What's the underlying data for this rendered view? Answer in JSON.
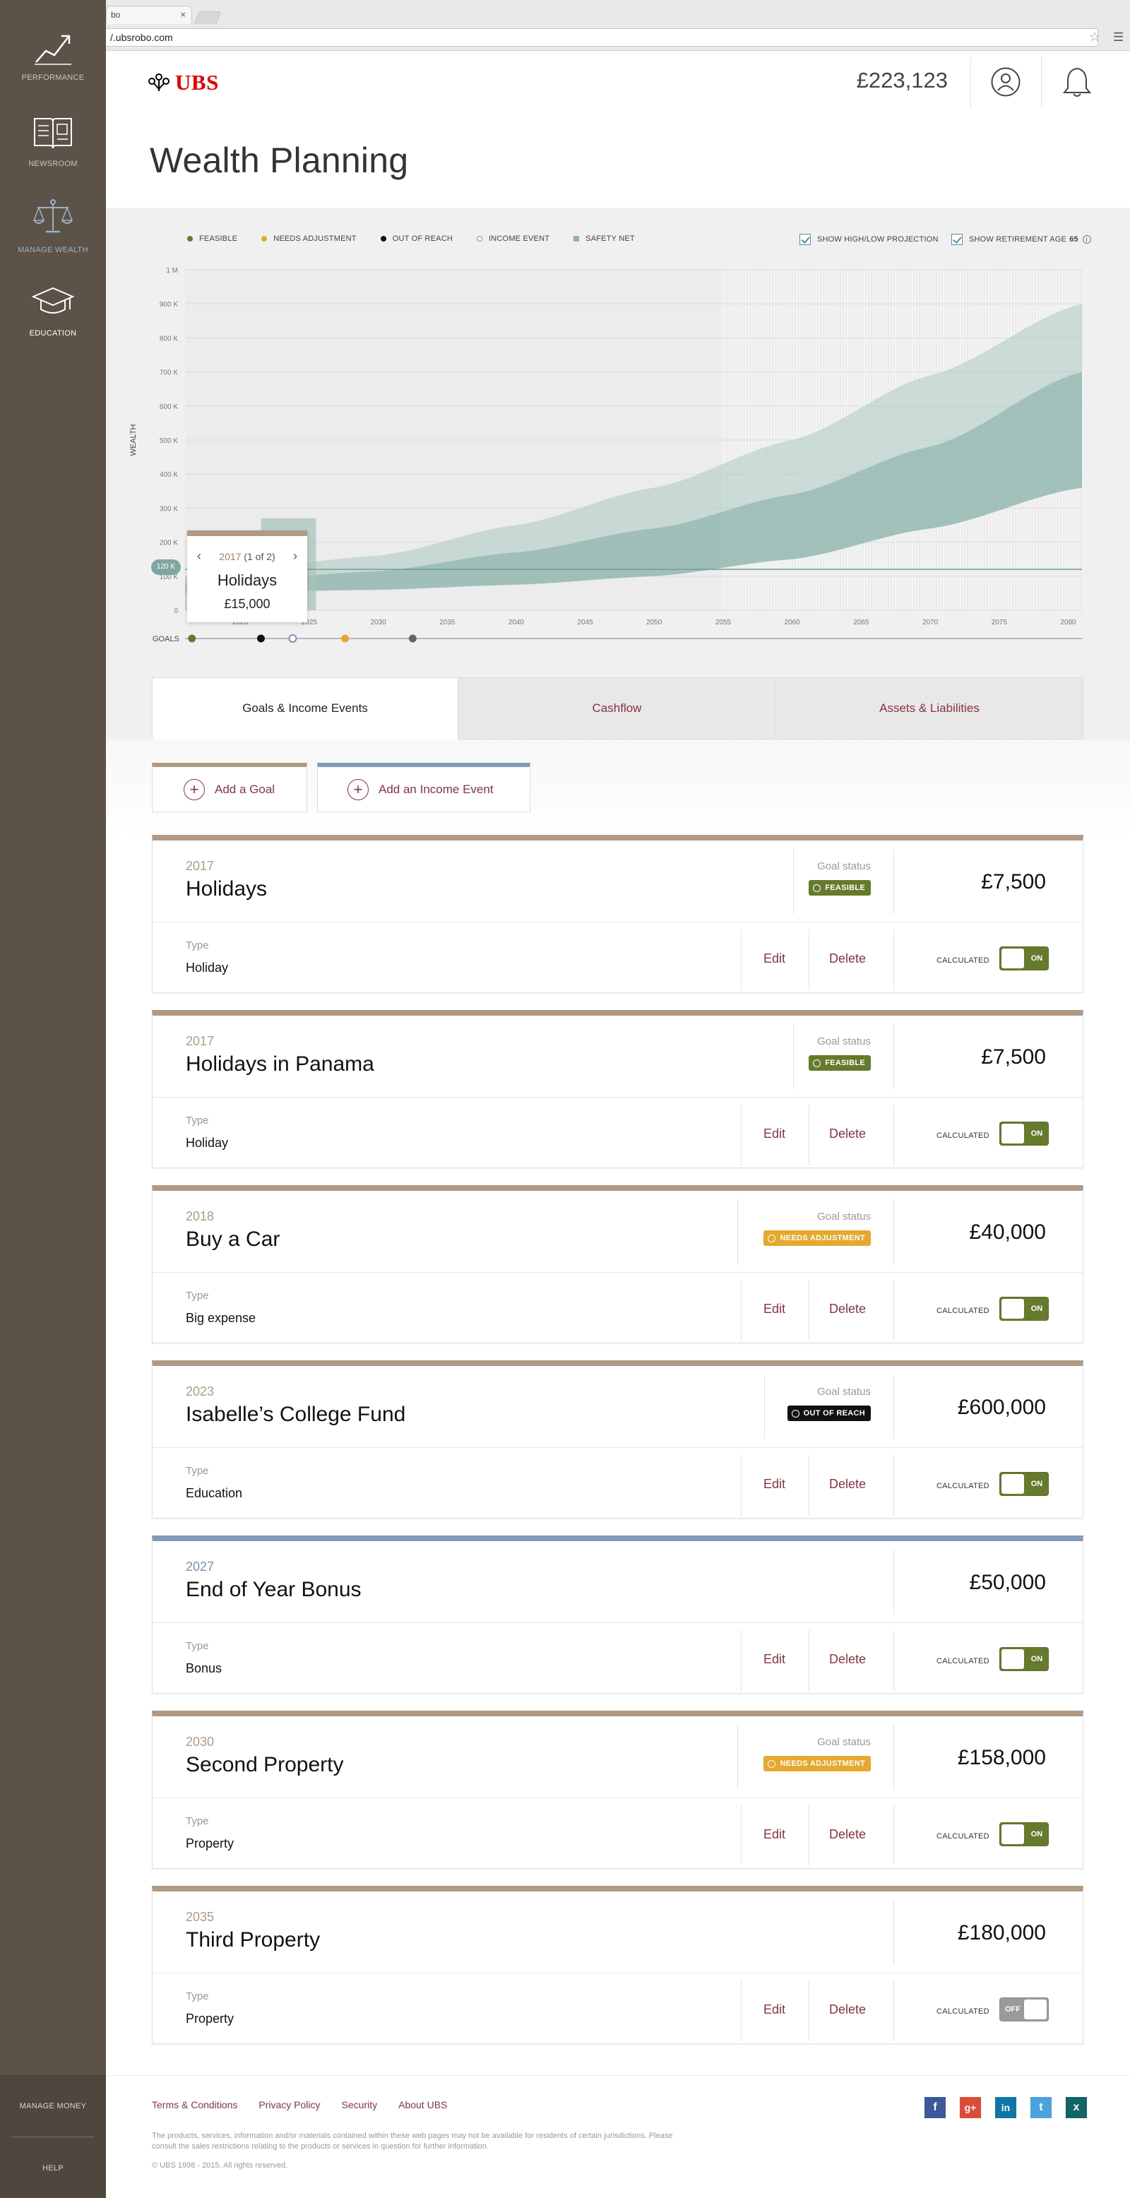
{
  "browser": {
    "tab_title": "bo",
    "tab_close": "×",
    "url": "/.ubsrobo.com",
    "star": "☆",
    "menu": "☰"
  },
  "sidebar": {
    "items": [
      {
        "label": "PERFORMANCE",
        "icon": "performance-chart-icon"
      },
      {
        "label": "NEWSROOM",
        "icon": "newsroom-book-icon"
      },
      {
        "label": "MANAGE WEALTH",
        "icon": "balance-scale-icon",
        "active": true
      },
      {
        "label": "EDUCATION",
        "icon": "graduation-cap-icon"
      }
    ],
    "manage_money": "MANAGE MONEY",
    "help": "HELP"
  },
  "header": {
    "logo_text": "UBS",
    "balance": "£223,123",
    "page_title": "Wealth Planning"
  },
  "legend": {
    "feasible": "FEASIBLE",
    "needs_adjustment": "NEEDS ADJUSTMENT",
    "out_of_reach": "OUT OF REACH",
    "income_event": "INCOME EVENT",
    "safety_net": "SAFETY NET",
    "show_projection": "SHOW HIGH/LOW PROJECTION",
    "show_retirement": "SHOW RETIREMENT AGE",
    "retirement_age": "65",
    "info": "i"
  },
  "colors": {
    "feasible": "#667a2c",
    "needs_adjustment": "#e6a92f",
    "out_of_reach": "#111111",
    "income_event": "#7b90b2",
    "safety_net": "#8db5ad",
    "accent": "#8a3340",
    "sidebar": "#5c5247"
  },
  "chart_data": {
    "type": "area",
    "ylabel": "WEALTH",
    "yticks": [
      "0",
      "100 K",
      "200 K",
      "300 K",
      "400 K",
      "500 K",
      "600 K",
      "700 K",
      "800 K",
      "900 K",
      "1 M"
    ],
    "ylim": [
      0,
      1000000
    ],
    "xticks": [
      "2020",
      "2025",
      "2030",
      "2035",
      "2040",
      "2045",
      "2050",
      "2055",
      "2060",
      "2065",
      "2070",
      "2075",
      "2080"
    ],
    "xlim": [
      2016,
      2081
    ],
    "safety_net_value": 120000,
    "safety_net_label": "120 K",
    "retirement_year": 2055,
    "series": [
      {
        "x": [
          2016,
          2030,
          2040,
          2050,
          2060,
          2070,
          2081
        ],
        "high": [
          100000,
          160000,
          250000,
          360000,
          500000,
          690000,
          900000
        ],
        "low": [
          50000,
          60000,
          75000,
          100000,
          150000,
          240000,
          360000
        ],
        "mid": [
          75000,
          115000,
          170000,
          240000,
          340000,
          480000,
          700000
        ]
      }
    ],
    "goals_label": "GOALS",
    "goal_markers": [
      {
        "year": 2016.5,
        "status": "feasible"
      },
      {
        "year": 2021.5,
        "status": "out_of_reach"
      },
      {
        "year": 2023.8,
        "status": "income_event"
      },
      {
        "year": 2027.6,
        "status": "needs_adjustment"
      },
      {
        "year": 2032.5,
        "status": "out_of_reach"
      }
    ]
  },
  "tooltip": {
    "year": "2017",
    "counter": "(1 of 2)",
    "title": "Holidays",
    "amount": "£15,000",
    "prev": "‹",
    "next": "›"
  },
  "tabs": [
    "Goals & Income Events",
    "Cashflow",
    "Assets & Liabilities"
  ],
  "actions": {
    "add_goal": "Add a Goal",
    "add_income": "Add an Income Event",
    "plus": "+"
  },
  "labels": {
    "goal_status": "Goal status",
    "type": "Type",
    "edit": "Edit",
    "delete": "Delete",
    "calculated": "CALCULATED",
    "on": "ON",
    "off": "OFF"
  },
  "goals": [
    {
      "year": "2017",
      "name": "Holidays",
      "status": "FEASIBLE",
      "status_key": "feasible",
      "amount": "£7,500",
      "type": "Holiday",
      "calculated": true,
      "kind": "goal"
    },
    {
      "year": "2017",
      "name": "Holidays in Panama",
      "status": "FEASIBLE",
      "status_key": "feasible",
      "amount": "£7,500",
      "type": "Holiday",
      "calculated": true,
      "kind": "goal"
    },
    {
      "year": "2018",
      "name": "Buy a Car",
      "status": "NEEDS ADJUSTMENT",
      "status_key": "adjust",
      "amount": "£40,000",
      "type": "Big expense",
      "calculated": true,
      "kind": "goal"
    },
    {
      "year": "2023",
      "name": "Isabelle’s College Fund",
      "status": "OUT OF REACH",
      "status_key": "reach",
      "amount": "£600,000",
      "type": "Education",
      "calculated": true,
      "kind": "goal"
    },
    {
      "year": "2027",
      "name": "End of Year Bonus",
      "status": "",
      "status_key": "",
      "amount": "£50,000",
      "type": "Bonus",
      "calculated": true,
      "kind": "income"
    },
    {
      "year": "2030",
      "name": "Second Property",
      "status": "NEEDS ADJUSTMENT",
      "status_key": "adjust",
      "amount": "£158,000",
      "type": "Property",
      "calculated": true,
      "kind": "goal"
    },
    {
      "year": "2035",
      "name": "Third Property",
      "status": "",
      "status_key": "",
      "amount": "£180,000",
      "type": "Property",
      "calculated": false,
      "kind": "goal"
    }
  ],
  "footer": {
    "links": [
      "Terms & Conditions",
      "Privacy Policy",
      "Security",
      "About UBS"
    ],
    "disclaimer": "The products, services, information and/or materials contained within these web pages may not be available for residents of certain jurisdictions. Please consult the sales restrictions relating to the products or services in question for further information.",
    "copyright": "© UBS 1998 - 2015. All rights reserved.",
    "social": [
      {
        "name": "facebook-icon",
        "glyph": "f",
        "color": "#3b5998"
      },
      {
        "name": "google-plus-icon",
        "glyph": "g+",
        "color": "#dd4b39"
      },
      {
        "name": "linkedin-icon",
        "glyph": "in",
        "color": "#0e76a8"
      },
      {
        "name": "twitter-icon",
        "glyph": "t",
        "color": "#4aa3df"
      },
      {
        "name": "xing-icon",
        "glyph": "x",
        "color": "#126567"
      }
    ]
  }
}
